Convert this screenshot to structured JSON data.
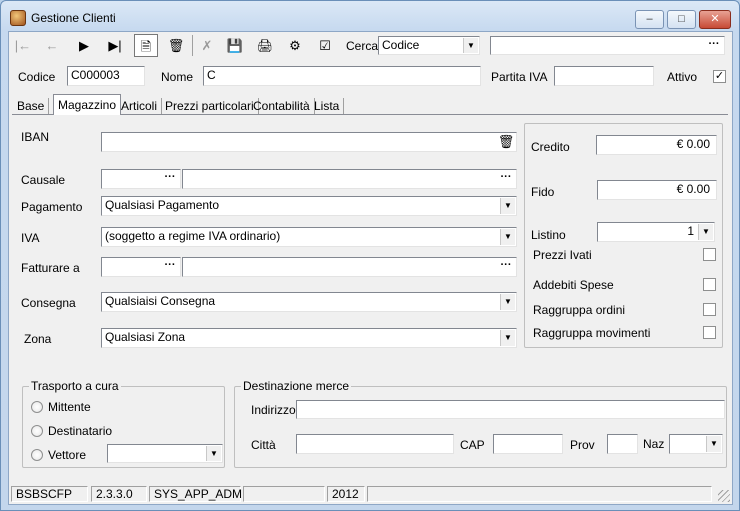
{
  "window": {
    "title": "Gestione Clienti"
  },
  "toolbar": {
    "search_label": "Cerca",
    "search_field": "Codice",
    "search_value": "",
    "buttons": [
      "first",
      "prev",
      "next",
      "last",
      "new",
      "delete",
      "cancel",
      "save",
      "print",
      "help",
      "confirm"
    ]
  },
  "header": {
    "codice_label": "Codice",
    "codice_value": "C000003",
    "nome_label": "Nome",
    "nome_value": "C",
    "piva_label": "Partita IVA",
    "piva_value": "",
    "attivo_label": "Attivo",
    "attivo_checked": true
  },
  "tabs": [
    {
      "label": "Base"
    },
    {
      "label": "Magazzino",
      "selected": true
    },
    {
      "label": "Articoli"
    },
    {
      "label": "Prezzi particolari"
    },
    {
      "label": "Contabilità"
    },
    {
      "label": "Lista"
    }
  ],
  "magazzino": {
    "iban_label": "IBAN",
    "iban_value": "",
    "causale_label": "Causale",
    "causale_code": "",
    "causale_desc": "",
    "pagamento_label": "Pagamento",
    "pagamento_value": "Qualsiasi Pagamento",
    "iva_label": "IVA",
    "iva_value": "(soggetto a regime IVA ordinario)",
    "fatturare_label": "Fatturare a",
    "fatturare_code": "",
    "fatturare_desc": "",
    "consegna_label": "Consegna",
    "consegna_value": "Qualsiaisi Consegna",
    "zona_label": "Zona",
    "zona_value": "Qualsiasi Zona"
  },
  "right_panel": {
    "credito_label": "Credito",
    "credito_value": "€ 0.00",
    "fido_label": "Fido",
    "fido_value": "€ 0.00",
    "listino_label": "Listino",
    "listino_value": "1",
    "prezzi_ivati_label": "Prezzi Ivati",
    "addebiti_label": "Addebiti Spese",
    "raggruppa_ordini_label": "Raggruppa ordini",
    "raggruppa_mov_label": "Raggruppa movimenti"
  },
  "trasporto": {
    "title": "Trasporto a cura",
    "mittente": "Mittente",
    "destinatario": "Destinatario",
    "vettore": "Vettore",
    "vettore_value": ""
  },
  "destinazione": {
    "title": "Destinazione merce",
    "indirizzo_label": "Indirizzo",
    "indirizzo_value": "",
    "citta_label": "Città",
    "citta_value": "",
    "cap_label": "CAP",
    "cap_value": "",
    "prov_label": "Prov",
    "prov_value": "",
    "naz_label": "Naz",
    "naz_value": ""
  },
  "status": {
    "db": "BSBSCFP",
    "version": "2.3.3.0",
    "user": "SYS_APP_ADM",
    "blank1": "",
    "year": "2012",
    "blank2": ""
  }
}
